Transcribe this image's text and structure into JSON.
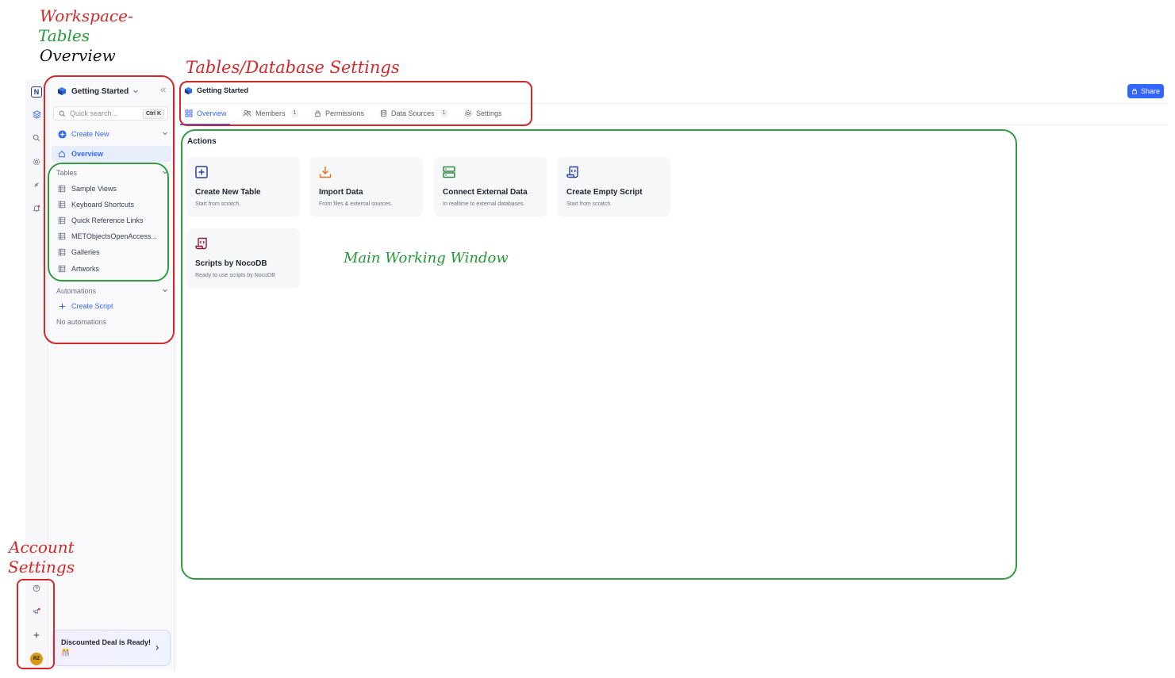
{
  "annotations": {
    "workspace_line1": "Workspace-",
    "workspace_line2": "Tables",
    "workspace_line3": "Overview",
    "tables_settings": "Tables/Database Settings",
    "main_window": "Main Working Window",
    "account_line1": "Account",
    "account_line2": "Settings"
  },
  "rail": {
    "logo": "N",
    "avatar_initials": "RZ"
  },
  "sidebar": {
    "base_name": "Getting Started",
    "search_placeholder": "Quick search...",
    "search_shortcut": "Ctrl K",
    "create_new": "Create New",
    "overview": "Overview",
    "tables_heading": "Tables",
    "tables": [
      "Sample Views",
      "Keyboard Shortcuts",
      "Quick Reference Links",
      "METObjectsOpenAccess...",
      "Galleries",
      "Artworks"
    ],
    "automations_heading": "Automations",
    "create_script": "Create Script",
    "no_automations": "No automations",
    "deal_text": "Discounted Deal is Ready!",
    "deal_emoji": "🎊"
  },
  "header": {
    "base_name": "Getting Started",
    "share": "Share"
  },
  "tabs": [
    {
      "label": "Overview",
      "count": ""
    },
    {
      "label": "Members",
      "count": "1"
    },
    {
      "label": "Permissions",
      "count": ""
    },
    {
      "label": "Data Sources",
      "count": "1"
    },
    {
      "label": "Settings",
      "count": ""
    }
  ],
  "main": {
    "actions_heading": "Actions",
    "cards": [
      {
        "title": "Create New Table",
        "subtitle": "Start from scratch.",
        "icon": "plus-square-icon"
      },
      {
        "title": "Import Data",
        "subtitle": "From files & external sources.",
        "icon": "download-icon"
      },
      {
        "title": "Connect External Data",
        "subtitle": "In realtime to external databases.",
        "icon": "server-icon"
      },
      {
        "title": "Create Empty Script",
        "subtitle": "Start from scratch.",
        "icon": "script-icon"
      },
      {
        "title": "Scripts by NocoDB",
        "subtitle": "Ready to use scripts by NocoDB",
        "icon": "script-icon"
      }
    ]
  },
  "colors": {
    "accent": "#3366ff",
    "annotation_red": "#d62828",
    "annotation_green": "#2e9e3f"
  }
}
